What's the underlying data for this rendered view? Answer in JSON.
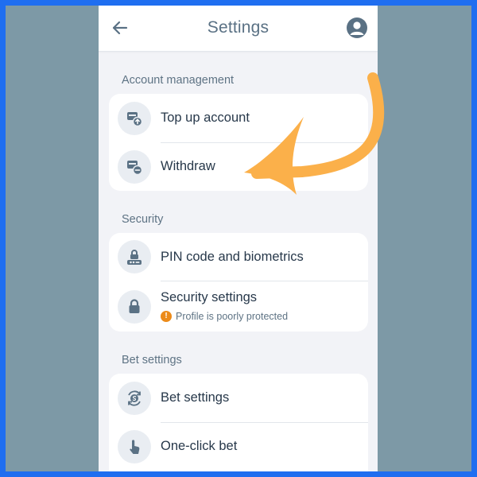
{
  "header": {
    "title": "Settings",
    "back_icon": "arrow-left-icon",
    "profile_icon": "user-circle-icon"
  },
  "sections": [
    {
      "title": "Account management",
      "items": [
        {
          "label": "Top up account",
          "icon": "wallet-deposit-icon"
        },
        {
          "label": "Withdraw",
          "icon": "wallet-withdraw-icon"
        }
      ]
    },
    {
      "title": "Security",
      "items": [
        {
          "label": "PIN code and biometrics",
          "icon": "pin-lock-icon"
        },
        {
          "label": "Security settings",
          "icon": "lock-icon",
          "warning": "Profile is poorly protected",
          "warning_icon": "exclamation-icon",
          "warning_mark": "!"
        }
      ]
    },
    {
      "title": "Bet settings",
      "items": [
        {
          "label": "Bet settings",
          "icon": "coin-settings-icon"
        },
        {
          "label": "One-click bet",
          "icon": "tap-hand-icon"
        }
      ]
    }
  ],
  "colors": {
    "frame_border": "#1f6ef0",
    "backdrop": "#7d99a6",
    "accent_text": "#5a7184",
    "warning": "#ec8b1a",
    "annotation_arrow": "#fbb04a"
  }
}
